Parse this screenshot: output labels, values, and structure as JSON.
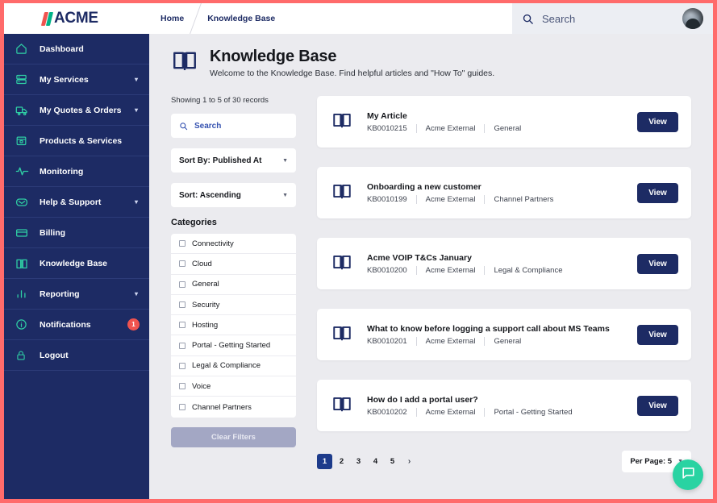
{
  "brand": {
    "name": "ACME",
    "accent_navy": "#1d2b64",
    "accent_teal": "#2fd0a5",
    "accent_coral": "#ff6b6b"
  },
  "topbar": {
    "breadcrumbs": [
      {
        "label": "Home"
      },
      {
        "label": "Knowledge Base"
      }
    ],
    "search_placeholder": "Search"
  },
  "sidebar": {
    "items": [
      {
        "label": "Dashboard",
        "icon": "home-icon",
        "caret": false,
        "badge": null
      },
      {
        "label": "My Services",
        "icon": "server-icon",
        "caret": true,
        "badge": null
      },
      {
        "label": "My Quotes & Orders",
        "icon": "truck-icon",
        "caret": true,
        "badge": null
      },
      {
        "label": "Products & Services",
        "icon": "bag-icon",
        "caret": false,
        "badge": null
      },
      {
        "label": "Monitoring",
        "icon": "pulse-icon",
        "caret": false,
        "badge": null
      },
      {
        "label": "Help & Support",
        "icon": "inbox-icon",
        "caret": true,
        "badge": null
      },
      {
        "label": "Billing",
        "icon": "credit-card-icon",
        "caret": false,
        "badge": null
      },
      {
        "label": "Knowledge Base",
        "icon": "book-icon",
        "caret": false,
        "badge": null
      },
      {
        "label": "Reporting",
        "icon": "bar-chart-icon",
        "caret": true,
        "badge": null
      },
      {
        "label": "Notifications",
        "icon": "info-circle-icon",
        "caret": false,
        "badge": "1"
      },
      {
        "label": "Logout",
        "icon": "lock-icon",
        "caret": false,
        "badge": null
      }
    ]
  },
  "page": {
    "title": "Knowledge Base",
    "subtitle": "Welcome to the Knowledge Base. Find helpful articles and \"How To\" guides."
  },
  "filters": {
    "records_text": "Showing 1 to 5 of 30 records",
    "search_placeholder": "Search",
    "search_value": "",
    "sort_by": "Sort By: Published At",
    "sort_dir": "Sort: Ascending",
    "categories_title": "Categories",
    "categories": [
      {
        "label": "Connectivity",
        "checked": false
      },
      {
        "label": "Cloud",
        "checked": false
      },
      {
        "label": "General",
        "checked": false
      },
      {
        "label": "Security",
        "checked": false
      },
      {
        "label": "Hosting",
        "checked": false
      },
      {
        "label": "Portal - Getting Started",
        "checked": false
      },
      {
        "label": "Legal & Compliance",
        "checked": false
      },
      {
        "label": "Voice",
        "checked": false
      },
      {
        "label": "Channel Partners",
        "checked": false
      }
    ],
    "clear_label": "Clear Filters"
  },
  "articles": [
    {
      "title": "My Article",
      "id": "KB0010215",
      "source": "Acme External",
      "category": "General",
      "action": "View"
    },
    {
      "title": "Onboarding a new customer",
      "id": "KB0010199",
      "source": "Acme External",
      "category": "Channel Partners",
      "action": "View"
    },
    {
      "title": "Acme VOIP T&Cs January",
      "id": "KB0010200",
      "source": "Acme External",
      "category": "Legal & Compliance",
      "action": "View"
    },
    {
      "title": "What to know before logging a support call about MS Teams",
      "id": "KB0010201",
      "source": "Acme External",
      "category": "General",
      "action": "View"
    },
    {
      "title": "How do I add a portal user?",
      "id": "KB0010202",
      "source": "Acme External",
      "category": "Portal - Getting Started",
      "action": "View"
    }
  ],
  "pagination": {
    "pages": [
      "1",
      "2",
      "3",
      "4",
      "5"
    ],
    "active": "1",
    "next_label": "›",
    "per_page_label": "Per Page: 5"
  },
  "chat": {
    "icon": "chat-bubble-icon"
  }
}
